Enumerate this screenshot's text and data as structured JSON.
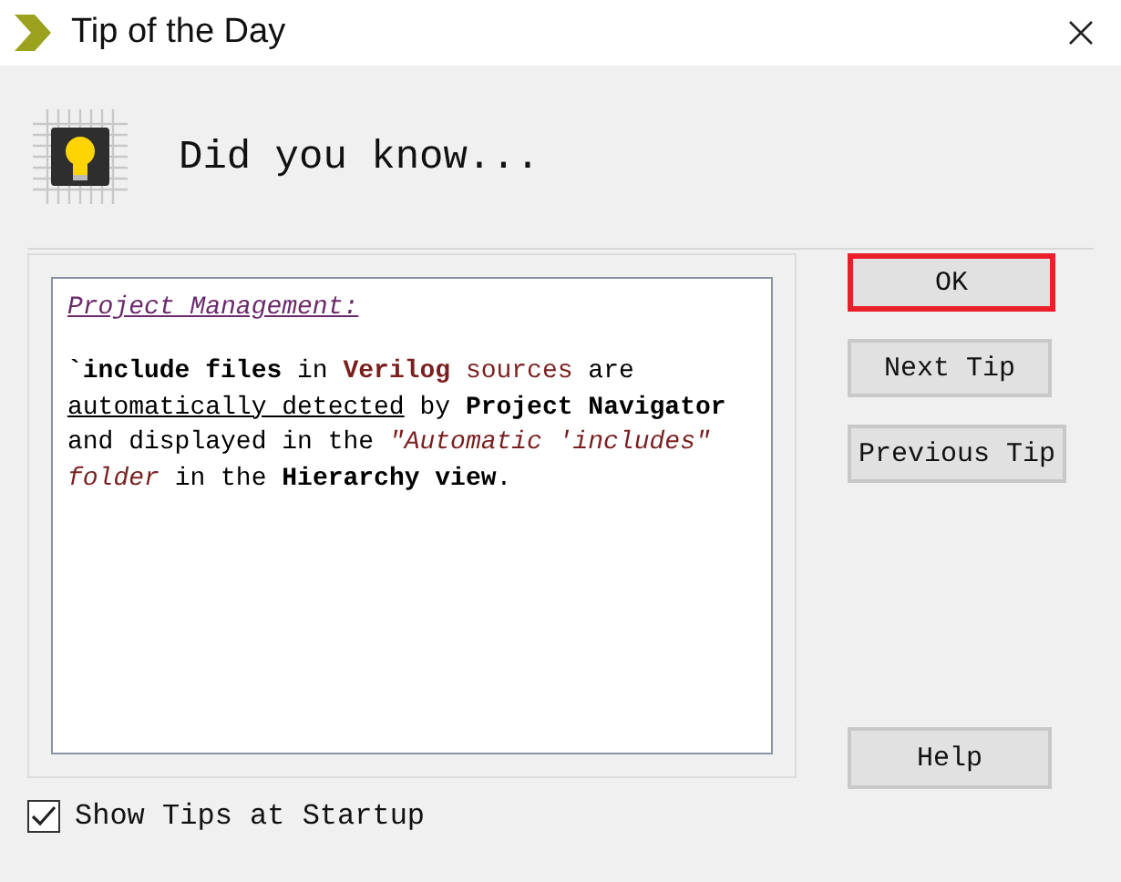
{
  "window": {
    "title": "Tip of the Day"
  },
  "header": "Did you know...",
  "tip": {
    "heading": "Project Management:",
    "segments": [
      {
        "text": "`include files",
        "kind": "bold"
      },
      {
        "text": " in ",
        "kind": "plain"
      },
      {
        "text": "Verilog",
        "kind": "keyword"
      },
      {
        "text": " sources",
        "kind": "term"
      },
      {
        "text": " are ",
        "kind": "plain"
      },
      {
        "text": "automatically detected",
        "kind": "underlined"
      },
      {
        "text": " by ",
        "kind": "plain"
      },
      {
        "text": "Project Navigator",
        "kind": "bold"
      },
      {
        "text": " and displayed in the ",
        "kind": "plain"
      },
      {
        "text": "\"Automatic 'includes\" folder",
        "kind": "quote"
      },
      {
        "text": " in the ",
        "kind": "plain"
      },
      {
        "text": "Hierarchy view",
        "kind": "bold"
      },
      {
        "text": ".",
        "kind": "plain"
      }
    ]
  },
  "buttons": [
    {
      "label": "OK",
      "highlighted": true
    },
    {
      "label": "Next Tip",
      "highlighted": false
    },
    {
      "label": "Previous Tip",
      "highlighted": false
    }
  ],
  "help_button": {
    "label": "Help"
  },
  "show_tips": {
    "label": "Show Tips at Startup",
    "checked": true
  }
}
